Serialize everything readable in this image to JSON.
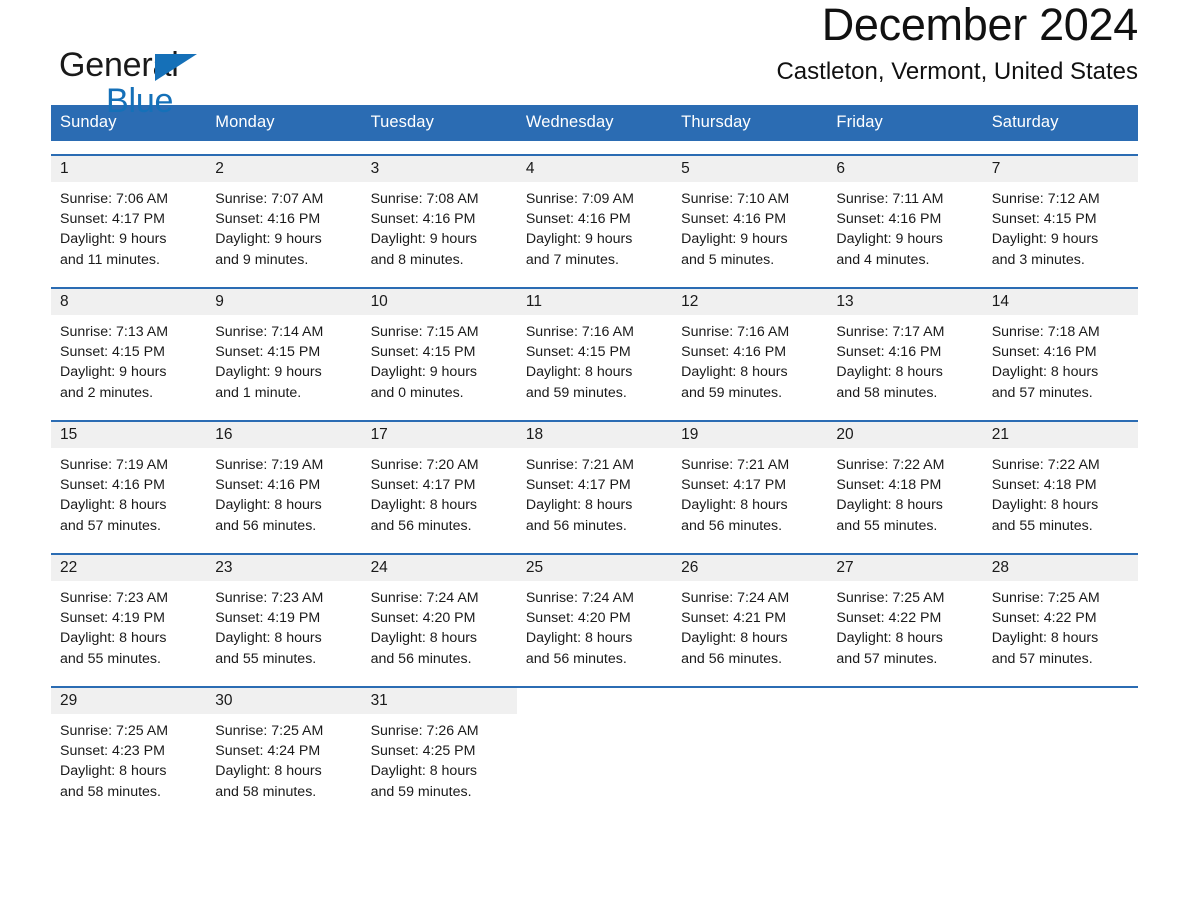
{
  "brand": {
    "name_part1": "General",
    "name_part2": "Blue",
    "logo_icon": "triangle-flag-icon"
  },
  "header": {
    "month_title": "December 2024",
    "location": "Castleton, Vermont, United States"
  },
  "colors": {
    "header_blue": "#2b6cb3",
    "brand_blue": "#1570b8",
    "daynum_band": "#f0f0f0",
    "text": "#1a1a1a"
  },
  "labels": {
    "sunrise": "Sunrise:",
    "sunset": "Sunset:",
    "daylight": "Daylight:"
  },
  "weekdays": [
    "Sunday",
    "Monday",
    "Tuesday",
    "Wednesday",
    "Thursday",
    "Friday",
    "Saturday"
  ],
  "weeks": [
    [
      {
        "day": "1",
        "sunrise": "Sunrise: 7:06 AM",
        "sunset": "Sunset: 4:17 PM",
        "daylight_line1": "Daylight: 9 hours",
        "daylight_line2": "and 11 minutes."
      },
      {
        "day": "2",
        "sunrise": "Sunrise: 7:07 AM",
        "sunset": "Sunset: 4:16 PM",
        "daylight_line1": "Daylight: 9 hours",
        "daylight_line2": "and 9 minutes."
      },
      {
        "day": "3",
        "sunrise": "Sunrise: 7:08 AM",
        "sunset": "Sunset: 4:16 PM",
        "daylight_line1": "Daylight: 9 hours",
        "daylight_line2": "and 8 minutes."
      },
      {
        "day": "4",
        "sunrise": "Sunrise: 7:09 AM",
        "sunset": "Sunset: 4:16 PM",
        "daylight_line1": "Daylight: 9 hours",
        "daylight_line2": "and 7 minutes."
      },
      {
        "day": "5",
        "sunrise": "Sunrise: 7:10 AM",
        "sunset": "Sunset: 4:16 PM",
        "daylight_line1": "Daylight: 9 hours",
        "daylight_line2": "and 5 minutes."
      },
      {
        "day": "6",
        "sunrise": "Sunrise: 7:11 AM",
        "sunset": "Sunset: 4:16 PM",
        "daylight_line1": "Daylight: 9 hours",
        "daylight_line2": "and 4 minutes."
      },
      {
        "day": "7",
        "sunrise": "Sunrise: 7:12 AM",
        "sunset": "Sunset: 4:15 PM",
        "daylight_line1": "Daylight: 9 hours",
        "daylight_line2": "and 3 minutes."
      }
    ],
    [
      {
        "day": "8",
        "sunrise": "Sunrise: 7:13 AM",
        "sunset": "Sunset: 4:15 PM",
        "daylight_line1": "Daylight: 9 hours",
        "daylight_line2": "and 2 minutes."
      },
      {
        "day": "9",
        "sunrise": "Sunrise: 7:14 AM",
        "sunset": "Sunset: 4:15 PM",
        "daylight_line1": "Daylight: 9 hours",
        "daylight_line2": "and 1 minute."
      },
      {
        "day": "10",
        "sunrise": "Sunrise: 7:15 AM",
        "sunset": "Sunset: 4:15 PM",
        "daylight_line1": "Daylight: 9 hours",
        "daylight_line2": "and 0 minutes."
      },
      {
        "day": "11",
        "sunrise": "Sunrise: 7:16 AM",
        "sunset": "Sunset: 4:15 PM",
        "daylight_line1": "Daylight: 8 hours",
        "daylight_line2": "and 59 minutes."
      },
      {
        "day": "12",
        "sunrise": "Sunrise: 7:16 AM",
        "sunset": "Sunset: 4:16 PM",
        "daylight_line1": "Daylight: 8 hours",
        "daylight_line2": "and 59 minutes."
      },
      {
        "day": "13",
        "sunrise": "Sunrise: 7:17 AM",
        "sunset": "Sunset: 4:16 PM",
        "daylight_line1": "Daylight: 8 hours",
        "daylight_line2": "and 58 minutes."
      },
      {
        "day": "14",
        "sunrise": "Sunrise: 7:18 AM",
        "sunset": "Sunset: 4:16 PM",
        "daylight_line1": "Daylight: 8 hours",
        "daylight_line2": "and 57 minutes."
      }
    ],
    [
      {
        "day": "15",
        "sunrise": "Sunrise: 7:19 AM",
        "sunset": "Sunset: 4:16 PM",
        "daylight_line1": "Daylight: 8 hours",
        "daylight_line2": "and 57 minutes."
      },
      {
        "day": "16",
        "sunrise": "Sunrise: 7:19 AM",
        "sunset": "Sunset: 4:16 PM",
        "daylight_line1": "Daylight: 8 hours",
        "daylight_line2": "and 56 minutes."
      },
      {
        "day": "17",
        "sunrise": "Sunrise: 7:20 AM",
        "sunset": "Sunset: 4:17 PM",
        "daylight_line1": "Daylight: 8 hours",
        "daylight_line2": "and 56 minutes."
      },
      {
        "day": "18",
        "sunrise": "Sunrise: 7:21 AM",
        "sunset": "Sunset: 4:17 PM",
        "daylight_line1": "Daylight: 8 hours",
        "daylight_line2": "and 56 minutes."
      },
      {
        "day": "19",
        "sunrise": "Sunrise: 7:21 AM",
        "sunset": "Sunset: 4:17 PM",
        "daylight_line1": "Daylight: 8 hours",
        "daylight_line2": "and 56 minutes."
      },
      {
        "day": "20",
        "sunrise": "Sunrise: 7:22 AM",
        "sunset": "Sunset: 4:18 PM",
        "daylight_line1": "Daylight: 8 hours",
        "daylight_line2": "and 55 minutes."
      },
      {
        "day": "21",
        "sunrise": "Sunrise: 7:22 AM",
        "sunset": "Sunset: 4:18 PM",
        "daylight_line1": "Daylight: 8 hours",
        "daylight_line2": "and 55 minutes."
      }
    ],
    [
      {
        "day": "22",
        "sunrise": "Sunrise: 7:23 AM",
        "sunset": "Sunset: 4:19 PM",
        "daylight_line1": "Daylight: 8 hours",
        "daylight_line2": "and 55 minutes."
      },
      {
        "day": "23",
        "sunrise": "Sunrise: 7:23 AM",
        "sunset": "Sunset: 4:19 PM",
        "daylight_line1": "Daylight: 8 hours",
        "daylight_line2": "and 55 minutes."
      },
      {
        "day": "24",
        "sunrise": "Sunrise: 7:24 AM",
        "sunset": "Sunset: 4:20 PM",
        "daylight_line1": "Daylight: 8 hours",
        "daylight_line2": "and 56 minutes."
      },
      {
        "day": "25",
        "sunrise": "Sunrise: 7:24 AM",
        "sunset": "Sunset: 4:20 PM",
        "daylight_line1": "Daylight: 8 hours",
        "daylight_line2": "and 56 minutes."
      },
      {
        "day": "26",
        "sunrise": "Sunrise: 7:24 AM",
        "sunset": "Sunset: 4:21 PM",
        "daylight_line1": "Daylight: 8 hours",
        "daylight_line2": "and 56 minutes."
      },
      {
        "day": "27",
        "sunrise": "Sunrise: 7:25 AM",
        "sunset": "Sunset: 4:22 PM",
        "daylight_line1": "Daylight: 8 hours",
        "daylight_line2": "and 57 minutes."
      },
      {
        "day": "28",
        "sunrise": "Sunrise: 7:25 AM",
        "sunset": "Sunset: 4:22 PM",
        "daylight_line1": "Daylight: 8 hours",
        "daylight_line2": "and 57 minutes."
      }
    ],
    [
      {
        "day": "29",
        "sunrise": "Sunrise: 7:25 AM",
        "sunset": "Sunset: 4:23 PM",
        "daylight_line1": "Daylight: 8 hours",
        "daylight_line2": "and 58 minutes."
      },
      {
        "day": "30",
        "sunrise": "Sunrise: 7:25 AM",
        "sunset": "Sunset: 4:24 PM",
        "daylight_line1": "Daylight: 8 hours",
        "daylight_line2": "and 58 minutes."
      },
      {
        "day": "31",
        "sunrise": "Sunrise: 7:26 AM",
        "sunset": "Sunset: 4:25 PM",
        "daylight_line1": "Daylight: 8 hours",
        "daylight_line2": "and 59 minutes."
      },
      {
        "day": "",
        "sunrise": "",
        "sunset": "",
        "daylight_line1": "",
        "daylight_line2": ""
      },
      {
        "day": "",
        "sunrise": "",
        "sunset": "",
        "daylight_line1": "",
        "daylight_line2": ""
      },
      {
        "day": "",
        "sunrise": "",
        "sunset": "",
        "daylight_line1": "",
        "daylight_line2": ""
      },
      {
        "day": "",
        "sunrise": "",
        "sunset": "",
        "daylight_line1": "",
        "daylight_line2": ""
      }
    ]
  ]
}
